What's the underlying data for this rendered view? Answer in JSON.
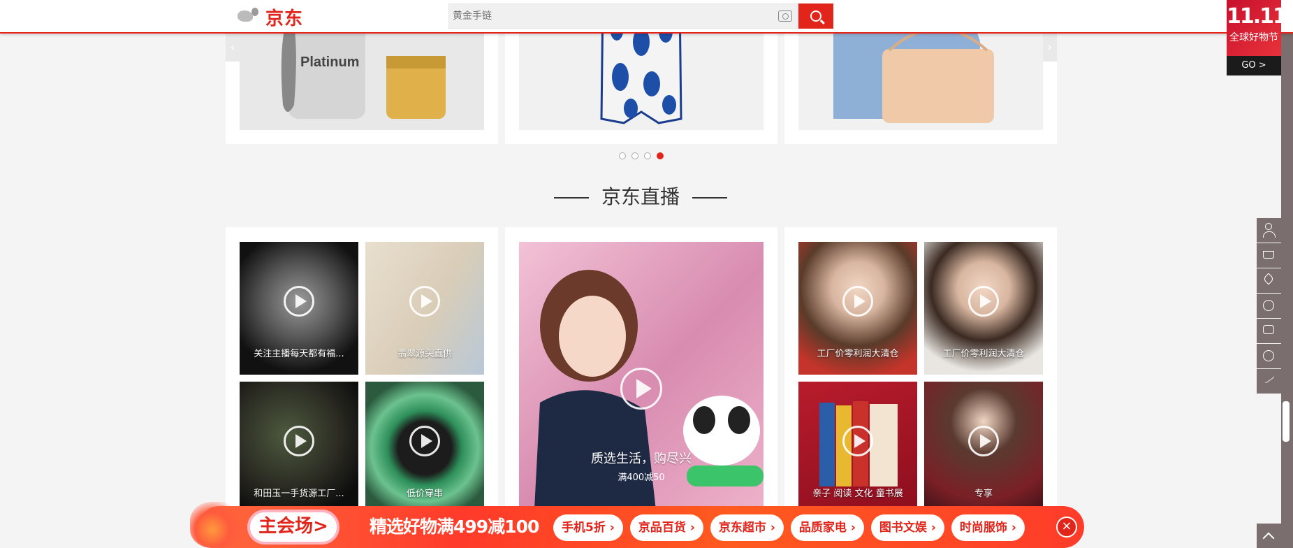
{
  "header": {
    "logo_text": "京东",
    "search_placeholder": "黄金手链"
  },
  "promo_corner": {
    "big": "11.11",
    "sub": "全球好物节",
    "go": "GO >"
  },
  "carousel": {
    "prev": "‹",
    "next": "›",
    "products": [
      {
        "name": "Platinum"
      },
      {
        "name": ""
      },
      {
        "name": ""
      }
    ],
    "active_dot": 4,
    "dot_count": 4
  },
  "section": {
    "title": "京东直播"
  },
  "live": {
    "left": [
      {
        "label": "关注主播每天都有福..."
      },
      {
        "label": "翡翠源头直供"
      },
      {
        "label": "和田玉一手货源工厂..."
      },
      {
        "label": "低价穿串"
      }
    ],
    "center": {
      "title": "质选生活，购尽兴",
      "sub": "满400减50"
    },
    "right": [
      {
        "label": "工厂价零利润大清仓"
      },
      {
        "label": "工厂价零利润大清仓"
      },
      {
        "label": "亲子 阅读 文化 童书展"
      },
      {
        "label": "专享"
      }
    ]
  },
  "promo_bar": {
    "main_venue": "主会场>",
    "deal": "精选好物满499减100",
    "links": [
      {
        "label": "手机5折"
      },
      {
        "label": "京品百货"
      },
      {
        "label": "京东超市"
      },
      {
        "label": "品质家电"
      },
      {
        "label": "图书文娱"
      },
      {
        "label": "时尚服饰"
      }
    ],
    "close": "×"
  },
  "colors": {
    "brand": "#e1251b",
    "sidebar": "#7a6e6e"
  }
}
